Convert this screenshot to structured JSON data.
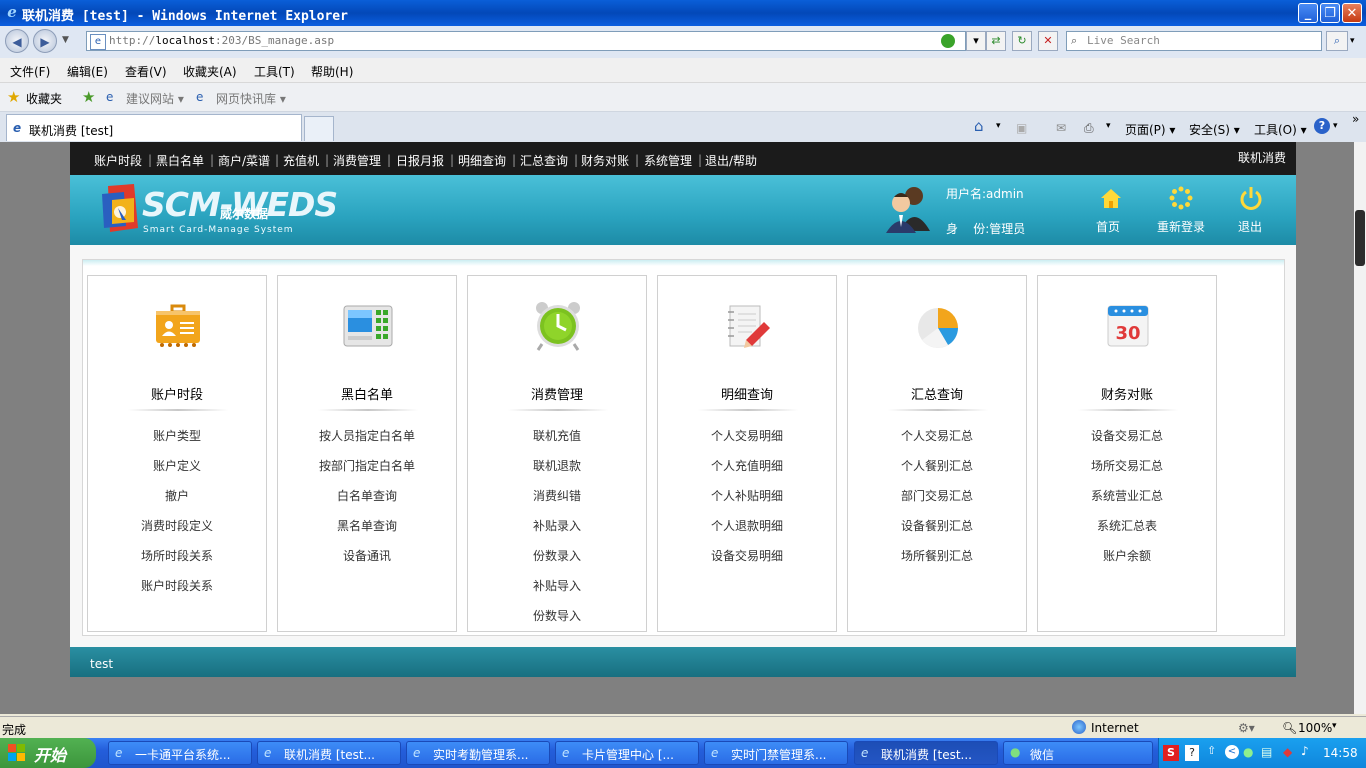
{
  "window": {
    "title": "联机消费 [test] - Windows Internet Explorer"
  },
  "address_bar": {
    "url_prefix": "http://",
    "url_host": "localhost",
    "url_rest": ":203/BS_manage.asp",
    "search_placeholder": "Live Search"
  },
  "menu": [
    "文件(F)",
    "编辑(E)",
    "查看(V)",
    "收藏夹(A)",
    "工具(T)",
    "帮助(H)"
  ],
  "favorites": {
    "label": "收藏夹",
    "links": [
      "建议网站 ▾",
      "网页快讯库 ▾"
    ]
  },
  "tabs": {
    "active": "联机消费 [test]"
  },
  "toolbar_right": [
    "页面(P) ▾",
    "安全(S) ▾",
    "工具(O) ▾"
  ],
  "page": {
    "top_nav": [
      "账户时段",
      "黑白名单",
      "商户/菜谱",
      "充值机",
      "消费管理",
      "日报月报",
      "明细查询",
      "汇总查询",
      "财务对账",
      "系统管理",
      "退出/帮助"
    ],
    "top_right": "联机消费",
    "logo_main": "SCM-WEDS",
    "logo_cn": "威尔数据",
    "logo_sub": "Smart Card-Manage System",
    "user_name": "用户名:admin",
    "user_role": "身    份:管理员",
    "header_buttons": [
      "首页",
      "重新登录",
      "退出"
    ],
    "columns": [
      {
        "title": "账户时段",
        "icon": "folder-user-icon",
        "items": [
          "账户类型",
          "账户定义",
          "撤户",
          "消费时段定义",
          "场所时段关系",
          "账户时段关系"
        ]
      },
      {
        "title": "黑白名单",
        "icon": "card-reader-icon",
        "items": [
          "按人员指定白名单",
          "按部门指定白名单",
          "白名单查询",
          "黑名单查询",
          "设备通讯"
        ]
      },
      {
        "title": "消费管理",
        "icon": "alarm-clock-icon",
        "items": [
          "联机充值",
          "联机退款",
          "消费纠错",
          "补贴录入",
          "份数录入",
          "补贴导入",
          "份数导入"
        ]
      },
      {
        "title": "明细查询",
        "icon": "notepad-icon",
        "items": [
          "个人交易明细",
          "个人充值明细",
          "个人补贴明细",
          "个人退款明细",
          "设备交易明细"
        ]
      },
      {
        "title": "汇总查询",
        "icon": "pie-chart-icon",
        "items": [
          "个人交易汇总",
          "个人餐别汇总",
          "部门交易汇总",
          "设备餐别汇总",
          "场所餐别汇总"
        ]
      },
      {
        "title": "财务对账",
        "icon": "calendar-icon",
        "items": [
          "设备交易汇总",
          "场所交易汇总",
          "系统营业汇总",
          "系统汇总表",
          "账户余额"
        ]
      }
    ],
    "footer": "test"
  },
  "status_bar": {
    "text": "完成",
    "zone": "Internet",
    "zoom": "100%"
  },
  "taskbar": {
    "start": "开始",
    "tasks": [
      "一卡通平台系统...",
      "联机消费 [test...",
      "实时考勤管理系...",
      "卡片管理中心 [...",
      "实时门禁管理系...",
      "联机消费 [test...",
      "微信"
    ],
    "clock": "14:58"
  }
}
